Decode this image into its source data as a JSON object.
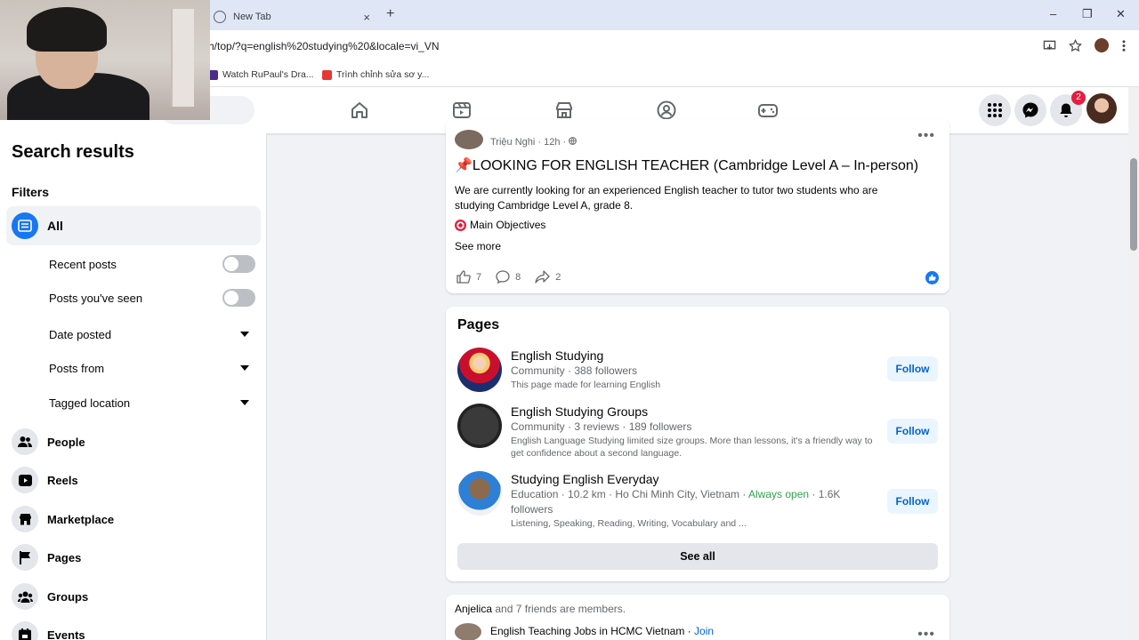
{
  "browser": {
    "tab_title": "New Tab",
    "tab_close": "×",
    "new_tab": "+",
    "url": "h/top/?q=english%20studying%20&locale=vi_VN",
    "bookmarks": [
      "Watch RuPaul's Dra...",
      "Trình chỉnh sửa sơ y..."
    ],
    "window_controls": [
      "–",
      "❐",
      "✕"
    ]
  },
  "header": {
    "notification_count": "2"
  },
  "sidebar": {
    "title": "Search results",
    "filters_label": "Filters",
    "all_label": "All",
    "sub_filters": [
      {
        "label": "Recent posts",
        "control": "toggle",
        "state": "off"
      },
      {
        "label": "Posts you've seen",
        "control": "toggle",
        "state": "off"
      },
      {
        "label": "Date posted",
        "control": "dropdown"
      },
      {
        "label": "Posts from",
        "control": "dropdown"
      },
      {
        "label": "Tagged location",
        "control": "dropdown"
      }
    ],
    "categories": [
      "People",
      "Reels",
      "Marketplace",
      "Pages",
      "Groups",
      "Events"
    ]
  },
  "post": {
    "author_line": "Triệu Nghi · 12h · ",
    "title": "📌LOOKING FOR ENGLISH TEACHER (Cambridge Level A – In-person)",
    "body": "We are currently looking for an experienced English teacher to tutor two students who are studying Cambridge Level A, grade 8.",
    "objectives": "Main Objectives",
    "see_more": "See more",
    "likes": "7",
    "comments": "8",
    "shares": "2"
  },
  "pages": {
    "title": "Pages",
    "items": [
      {
        "name": "English Studying",
        "meta": "Community · 388 followers",
        "desc": "This page made for learning English",
        "follow": "Follow"
      },
      {
        "name": "English Studying Groups",
        "meta": "Community · 3 reviews · 189 followers",
        "desc": "English Language Studying limited size groups. More than lessons, it's a friendly way to get confidence about a second language.",
        "follow": "Follow"
      },
      {
        "name": "Studying English Everyday",
        "meta_prefix": "Education · 10.2 km · Ho Chi Minh City, Vietnam · ",
        "meta_open": "Always open",
        "meta_suffix": " · 1.6K followers",
        "desc": "Listening, Speaking, Reading, Writing, Vocabulary and ...",
        "follow": "Follow"
      }
    ],
    "see_all": "See all"
  },
  "group": {
    "member_name": "Anjelica",
    "member_text": " and 7 friends are members.",
    "name": "English Teaching Jobs in HCMC Vietnam",
    "separator": " · ",
    "join": "Join"
  },
  "colors": {
    "accent": "#1877f2",
    "follow_bg": "#ebf5ff",
    "follow_text": "#0064d1",
    "open_green": "#31a24c",
    "badge_red": "#e41e3f"
  }
}
